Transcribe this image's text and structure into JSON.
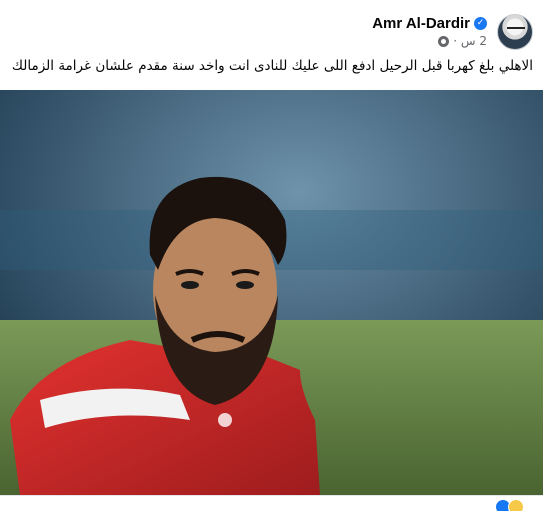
{
  "post": {
    "author_name": "Amr Al-Dardir",
    "time": "2 س ·",
    "caption": "الاهلي بلغ كهربا قبل الرحيل ادفع اللى عليك للنادى انت واخد سنة مقدم علشان غرامة الزمالك",
    "icons": {
      "verified": "verified-badge-icon",
      "privacy": "globe-icon",
      "emoji": "laughing-crying-emoji"
    },
    "photo_alt": "player-photo"
  },
  "colors": {
    "name": "#050505",
    "meta": "#65676b",
    "verified": "#1877f2",
    "jersey": "#d8262b"
  }
}
